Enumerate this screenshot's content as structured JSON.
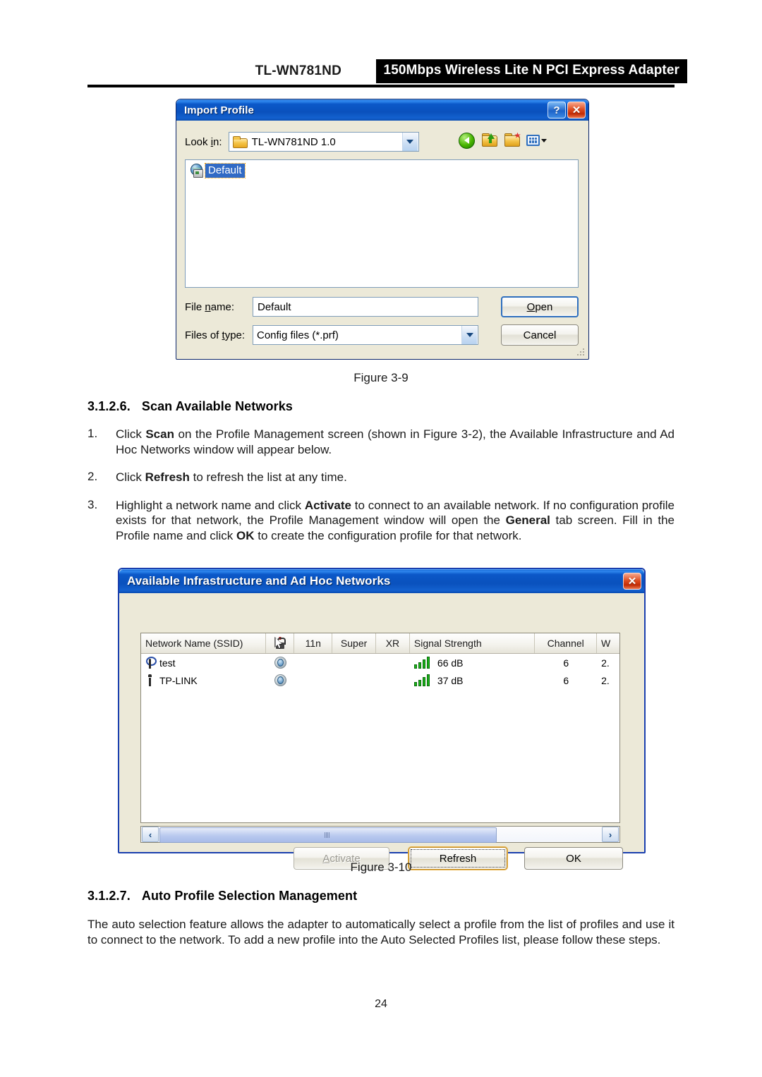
{
  "header": {
    "model": "TL-WN781ND",
    "product": "150Mbps Wireless Lite N PCI Express Adapter"
  },
  "import_dialog": {
    "title": "Import Profile",
    "help_label": "?",
    "close_label": "✕",
    "lookin_label_pre": "Look ",
    "lookin_label_key": "i",
    "lookin_label_post": "n:",
    "lookin_value": "TL-WN781ND 1.0",
    "toolbar": {
      "back": "back-icon",
      "up": "up-one-level-icon",
      "new_folder": "new-folder-icon",
      "views": "views-icon"
    },
    "files": [
      {
        "name": "Default",
        "selected": true
      }
    ],
    "filename_label_pre": "File ",
    "filename_label_key": "n",
    "filename_label_post": "ame:",
    "filename_value": "Default",
    "filetype_label_pre": "Files of ",
    "filetype_label_key": "t",
    "filetype_label_post": "ype:",
    "filetype_value": "Config files (*.prf)",
    "open_label_pre": "",
    "open_label_key": "O",
    "open_label_post": "pen",
    "cancel_label": "Cancel"
  },
  "caption_3_9": "Figure 3-9",
  "section_scan": {
    "number": "3.1.2.6.",
    "title": "Scan Available Networks",
    "steps": [
      {
        "no": "1.",
        "parts": [
          {
            "t": "Click "
          },
          {
            "t": "Scan",
            "b": true
          },
          {
            "t": " on the Profile Management screen (shown in Figure 3-2), the Available Infrastructure and Ad Hoc Networks window will appear below."
          }
        ]
      },
      {
        "no": "2.",
        "parts": [
          {
            "t": "Click "
          },
          {
            "t": "Refresh",
            "b": true
          },
          {
            "t": " to refresh the list at any time."
          }
        ]
      },
      {
        "no": "3.",
        "parts": [
          {
            "t": "Highlight a network name and click "
          },
          {
            "t": "Activate",
            "b": true
          },
          {
            "t": " to connect to an available network. If no configuration profile exists for that network, the Profile Management window will open the "
          },
          {
            "t": "General",
            "b": true
          },
          {
            "t": " tab screen. Fill in the Profile name and click "
          },
          {
            "t": "OK",
            "b": true
          },
          {
            "t": " to create the configuration profile for that network."
          }
        ]
      }
    ]
  },
  "networks_dialog": {
    "title": "Available Infrastructure and Ad Hoc Networks",
    "close_label": "✕",
    "columns": [
      {
        "key": "ssid",
        "label": "Network Name (SSID)"
      },
      {
        "key": "sec",
        "label": ""
      },
      {
        "key": "c11n",
        "label": "11n"
      },
      {
        "key": "super",
        "label": "Super"
      },
      {
        "key": "xr",
        "label": "XR"
      },
      {
        "key": "sig",
        "label": "Signal Strength"
      },
      {
        "key": "chan",
        "label": "Channel"
      },
      {
        "key": "wmode",
        "label": "W"
      }
    ],
    "rows": [
      {
        "ssid": "test",
        "type": "infrastructure",
        "c11n": "",
        "super": "",
        "xr": "",
        "signal": "66 dB",
        "bars": 4,
        "channel": "6",
        "wmode": "2."
      },
      {
        "ssid": "TP-LINK",
        "type": "adhoc",
        "c11n": "",
        "super": "",
        "xr": "",
        "signal": "37 dB",
        "bars": 4,
        "channel": "6",
        "wmode": "2."
      }
    ],
    "scroll_left": "‹",
    "scroll_right": "›",
    "activate_label_pre": "",
    "activate_label_key": "A",
    "activate_label_post": "ctivate",
    "activate_disabled": true,
    "refresh_label": "Refresh",
    "refresh_focused": true,
    "ok_label": "OK"
  },
  "caption_3_10": "Figure 3-10",
  "section_auto": {
    "number": "3.1.2.7.",
    "title": "Auto Profile Selection Management",
    "paragraph": "The auto selection feature allows the adapter to automatically select a profile from the list of profiles and use it to connect to the network. To add a new profile into the Auto Selected Profiles list, please follow these steps."
  },
  "page_number": "24",
  "colors": {
    "title_blue": "#0a51bd",
    "selection_blue": "#316ac5",
    "dialog_face": "#ece9d8",
    "signal_green": "#19b219",
    "close_red": "#c32c06"
  }
}
